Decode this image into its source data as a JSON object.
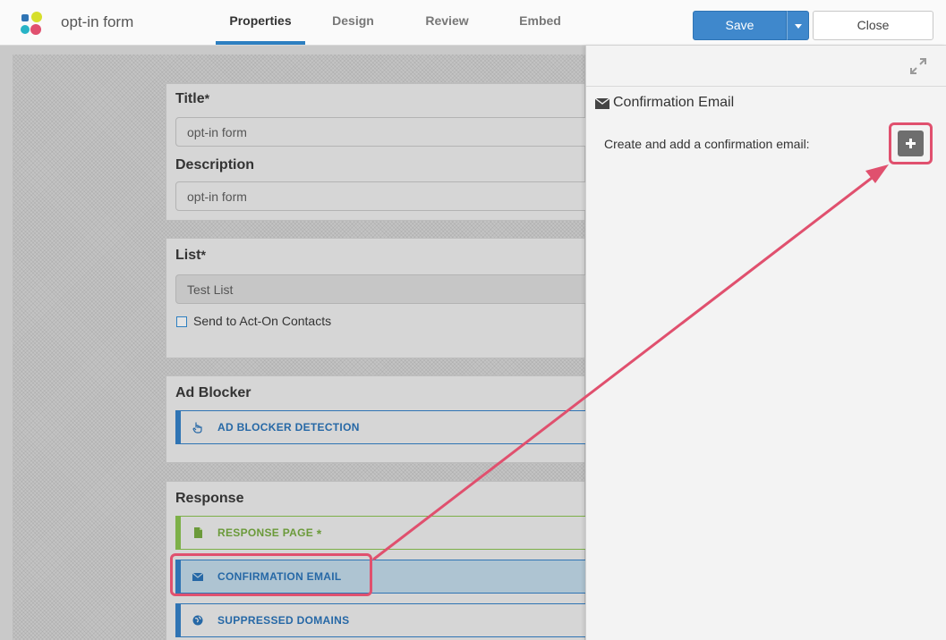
{
  "header": {
    "app_title": "opt-in form",
    "tabs": [
      {
        "label": "Properties",
        "active": true
      },
      {
        "label": "Design",
        "active": false
      },
      {
        "label": "Review",
        "active": false
      },
      {
        "label": "Embed",
        "active": false
      }
    ],
    "save_label": "Save",
    "close_label": "Close"
  },
  "form": {
    "title_label": "Title",
    "title_value": "opt-in form",
    "description_label": "Description",
    "description_value": "opt-in form",
    "list_label": "List",
    "list_value": "Test List",
    "send_contacts_label": "Send to Act-On Contacts",
    "required_marker": "*",
    "ad_blocker": {
      "title": "Ad Blocker",
      "item": "AD BLOCKER DETECTION"
    },
    "response": {
      "title": "Response",
      "items": [
        {
          "label": "RESPONSE PAGE",
          "required": "*",
          "icon": "file-icon"
        },
        {
          "label": "CONFIRMATION EMAIL",
          "icon": "envelope-icon"
        },
        {
          "label": "SUPPRESSED DOMAINS",
          "icon": "globe-icon"
        }
      ]
    }
  },
  "panel": {
    "title": "Confirmation Email",
    "description": "Create and add a confirmation email:"
  },
  "colors": {
    "accent": "#3f88cc",
    "annotation": "#e0506e",
    "success": "#7db048"
  }
}
